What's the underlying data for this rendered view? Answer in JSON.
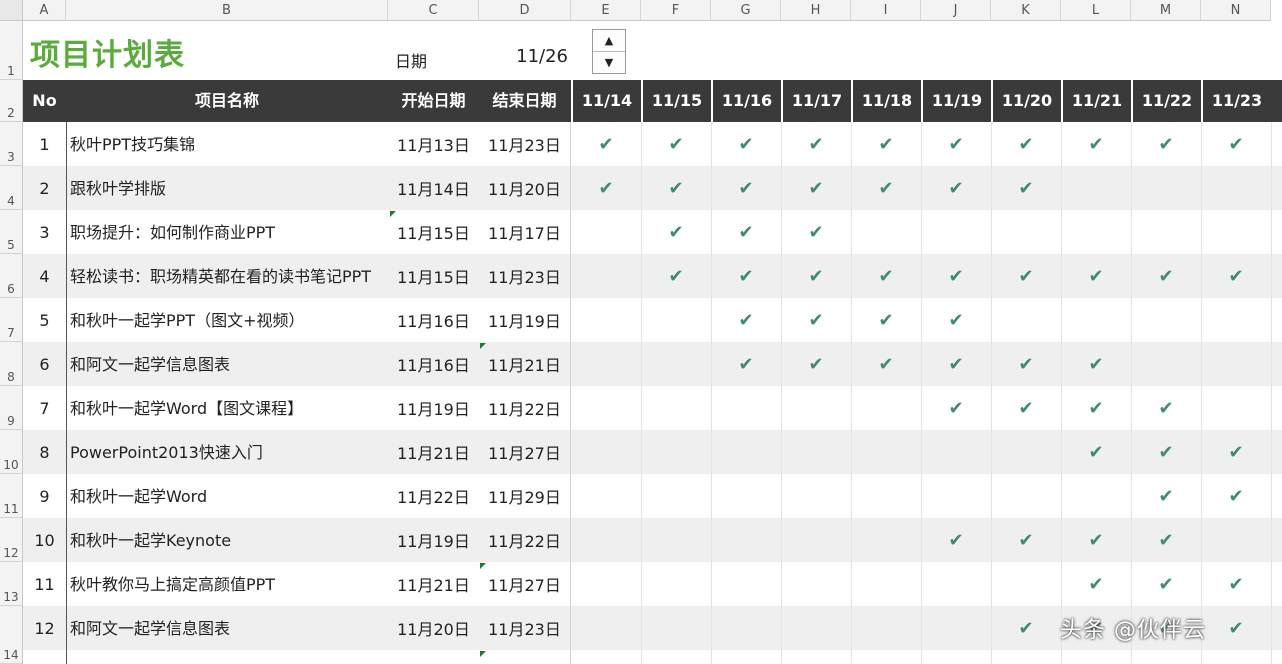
{
  "sheet": {
    "title": "项目计划表",
    "date_label": "日期",
    "date_value": "11/26",
    "column_letters": [
      "A",
      "B",
      "C",
      "D",
      "E",
      "F",
      "G",
      "H",
      "I",
      "J",
      "K",
      "L",
      "M",
      "N"
    ],
    "row_numbers": [
      "1",
      "2",
      "3",
      "4",
      "5",
      "6",
      "7",
      "8",
      "9",
      "10",
      "11",
      "12",
      "13",
      "14"
    ],
    "header": {
      "no": "No",
      "name": "项目名称",
      "start": "开始日期",
      "end": "结束日期",
      "days": [
        "11/14",
        "11/15",
        "11/16",
        "11/17",
        "11/18",
        "11/19",
        "11/20",
        "11/21",
        "11/22",
        "11/23"
      ]
    },
    "check_symbol": "✔",
    "spinner_up": "▲",
    "spinner_down": "▼",
    "accent_color": "#5aaa3c",
    "check_color": "#3f8a72",
    "rows": [
      {
        "no": "1",
        "name": "秋叶PPT技巧集锦",
        "start": "11月13日",
        "end": "11月23日",
        "checks": [
          1,
          1,
          1,
          1,
          1,
          1,
          1,
          1,
          1,
          1
        ]
      },
      {
        "no": "2",
        "name": "跟秋叶学排版",
        "start": "11月14日",
        "end": "11月20日",
        "checks": [
          1,
          1,
          1,
          1,
          1,
          1,
          1,
          0,
          0,
          0
        ]
      },
      {
        "no": "3",
        "name": "职场提升：如何制作商业PPT",
        "start": "11月15日",
        "end": "11月17日",
        "checks": [
          0,
          1,
          1,
          1,
          0,
          0,
          0,
          0,
          0,
          0
        ]
      },
      {
        "no": "4",
        "name": "轻松读书：职场精英都在看的读书笔记PPT",
        "start": "11月15日",
        "end": "11月23日",
        "checks": [
          0,
          1,
          1,
          1,
          1,
          1,
          1,
          1,
          1,
          1
        ]
      },
      {
        "no": "5",
        "name": "和秋叶一起学PPT（图文+视频）",
        "start": "11月16日",
        "end": "11月19日",
        "checks": [
          0,
          0,
          1,
          1,
          1,
          1,
          0,
          0,
          0,
          0
        ]
      },
      {
        "no": "6",
        "name": "和阿文一起学信息图表",
        "start": "11月16日",
        "end": "11月21日",
        "checks": [
          0,
          0,
          1,
          1,
          1,
          1,
          1,
          1,
          0,
          0
        ]
      },
      {
        "no": "7",
        "name": "和秋叶一起学Word【图文课程】",
        "start": "11月19日",
        "end": "11月22日",
        "checks": [
          0,
          0,
          0,
          0,
          0,
          1,
          1,
          1,
          1,
          0
        ]
      },
      {
        "no": "8",
        "name": "PowerPoint2013快速入门",
        "start": "11月21日",
        "end": "11月27日",
        "checks": [
          0,
          0,
          0,
          0,
          0,
          0,
          0,
          1,
          1,
          1
        ]
      },
      {
        "no": "9",
        "name": "和秋叶一起学Word",
        "start": "11月22日",
        "end": "11月29日",
        "checks": [
          0,
          0,
          0,
          0,
          0,
          0,
          0,
          0,
          1,
          1
        ]
      },
      {
        "no": "10",
        "name": "和秋叶一起学Keynote",
        "start": "11月19日",
        "end": "11月22日",
        "checks": [
          0,
          0,
          0,
          0,
          0,
          1,
          1,
          1,
          1,
          0
        ]
      },
      {
        "no": "11",
        "name": "秋叶教你马上搞定高颜值PPT",
        "start": "11月21日",
        "end": "11月27日",
        "checks": [
          0,
          0,
          0,
          0,
          0,
          0,
          0,
          1,
          1,
          1
        ]
      },
      {
        "no": "12",
        "name": "和阿文一起学信息图表",
        "start": "11月20日",
        "end": "11月23日",
        "checks": [
          0,
          0,
          0,
          0,
          0,
          0,
          1,
          1,
          1,
          1
        ]
      }
    ]
  },
  "watermark": "头条 @伙伴云"
}
